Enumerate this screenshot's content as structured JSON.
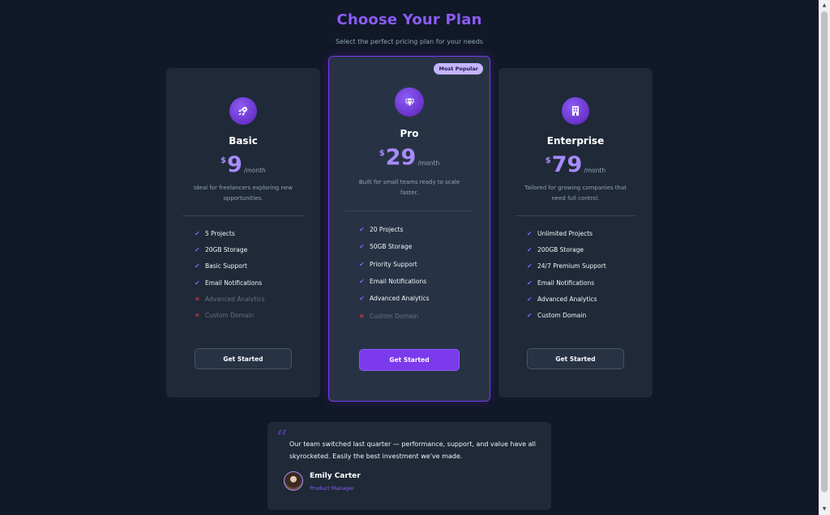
{
  "header": {
    "title": "Choose Your Plan",
    "subtitle": "Select the perfect pricing plan for your needs"
  },
  "plans": [
    {
      "name": "Basic",
      "currency": "$",
      "price": "9",
      "period": "/month",
      "description": "Ideal for freelancers exploring new opportunities.",
      "icon": "rocket-icon",
      "features": [
        {
          "label": "5 Projects",
          "included": true
        },
        {
          "label": "20GB Storage",
          "included": true
        },
        {
          "label": "Basic Support",
          "included": true
        },
        {
          "label": "Email Notifications",
          "included": true
        },
        {
          "label": "Advanced Analytics",
          "included": false
        },
        {
          "label": "Custom Domain",
          "included": false
        }
      ],
      "button": "Get Started"
    },
    {
      "name": "Pro",
      "badge": "Most Popular",
      "currency": "$",
      "price": "29",
      "period": "/month",
      "description": "Built for small teams ready to scale faster.",
      "icon": "diamond-icon",
      "features": [
        {
          "label": "20 Projects",
          "included": true
        },
        {
          "label": "50GB Storage",
          "included": true
        },
        {
          "label": "Priority Support",
          "included": true
        },
        {
          "label": "Email Notifications",
          "included": true
        },
        {
          "label": "Advanced Analytics",
          "included": true
        },
        {
          "label": "Custom Domain",
          "included": false
        }
      ],
      "button": "Get Started"
    },
    {
      "name": "Enterprise",
      "currency": "$",
      "price": "79",
      "period": "/month",
      "description": "Tailored for growing companies that need full control.",
      "icon": "building-icon",
      "features": [
        {
          "label": "Unlimited Projects",
          "included": true
        },
        {
          "label": "200GB Storage",
          "included": true
        },
        {
          "label": "24/7 Premium Support",
          "included": true
        },
        {
          "label": "Email Notifications",
          "included": true
        },
        {
          "label": "Advanced Analytics",
          "included": true
        },
        {
          "label": "Custom Domain",
          "included": true
        }
      ],
      "button": "Get Started"
    }
  ],
  "testimonial": {
    "quote_mark": "“",
    "text": "Our team switched last quarter — performance, support, and value have all skyrocketed. Easily the best investment we've made.",
    "author": "Emily Carter",
    "role": "Product Manager"
  },
  "icons": {
    "check": "✔",
    "cross": "✕",
    "scroll_up": "▲",
    "scroll_down": "▼"
  },
  "colors": {
    "background": "#111827",
    "card": "#1f2937",
    "accent": "#8b5cf6",
    "badge": "#c4b5fd",
    "cross": "#ef4444"
  }
}
